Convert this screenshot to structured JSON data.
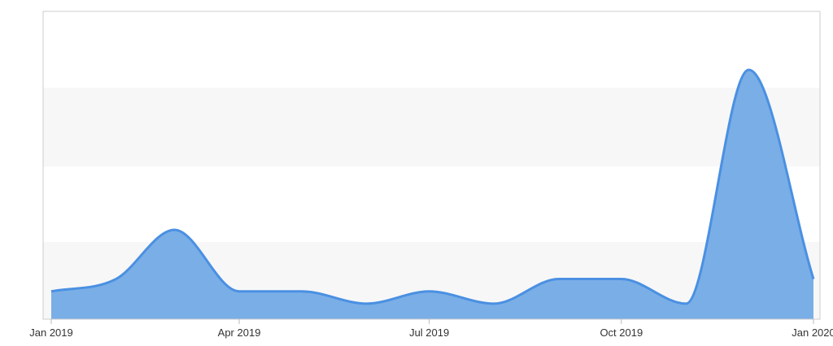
{
  "chart_data": {
    "type": "area",
    "title": "",
    "xlabel": "",
    "ylabel": "",
    "x_ticks": [
      "Jan 2019",
      "Apr 2019",
      "Jul 2019",
      "Oct 2019",
      "Jan 2020"
    ],
    "x": [
      "2019-01-01",
      "2019-02-01",
      "2019-03-01",
      "2019-04-01",
      "2019-05-01",
      "2019-06-01",
      "2019-07-01",
      "2019-08-01",
      "2019-09-01",
      "2019-10-01",
      "2019-11-01",
      "2019-12-01",
      "2020-01-01"
    ],
    "series": [
      {
        "values": [
          2,
          3,
          7,
          2,
          2,
          1,
          2,
          1,
          3,
          3,
          1,
          20,
          3
        ]
      }
    ],
    "ylim": [
      0,
      20
    ],
    "grid": "alternating horizontal bands",
    "colors": {
      "fill": "#7aaee6",
      "stroke": "#4a90e2",
      "band": "#f7f7f7",
      "frame": "#cccccc"
    }
  }
}
